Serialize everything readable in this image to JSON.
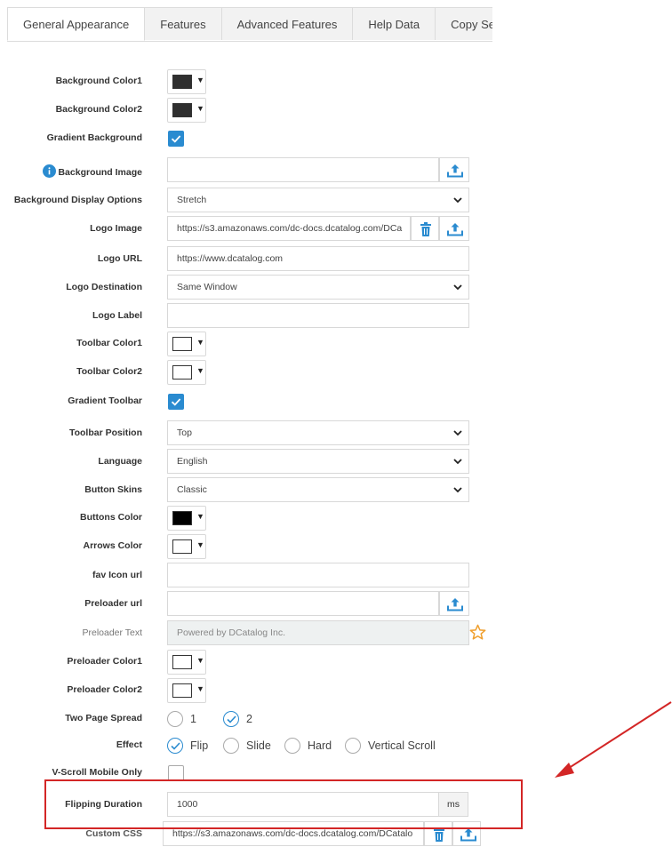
{
  "tabs": [
    "General Appearance",
    "Features",
    "Advanced Features",
    "Help Data",
    "Copy Set"
  ],
  "form": {
    "background_color1": {
      "label": "Background Color1",
      "color": "#2f2f2f"
    },
    "background_color2": {
      "label": "Background Color2",
      "color": "#2f2f2f"
    },
    "gradient_background": {
      "label": "Gradient Background",
      "checked": true
    },
    "background_image": {
      "label": "Background Image",
      "value": ""
    },
    "background_display_options": {
      "label": "Background Display Options",
      "value": "Stretch"
    },
    "logo_image": {
      "label": "Logo Image",
      "value": "https://s3.amazonaws.com/dc-docs.dcatalog.com/DCa"
    },
    "logo_url": {
      "label": "Logo URL",
      "value": "https://www.dcatalog.com"
    },
    "logo_destination": {
      "label": "Logo Destination",
      "value": "Same Window"
    },
    "logo_label": {
      "label": "Logo Label",
      "value": ""
    },
    "toolbar_color1": {
      "label": "Toolbar Color1",
      "color": "#ffffff"
    },
    "toolbar_color2": {
      "label": "Toolbar Color2",
      "color": "#ffffff"
    },
    "gradient_toolbar": {
      "label": "Gradient Toolbar",
      "checked": true
    },
    "toolbar_position": {
      "label": "Toolbar Position",
      "value": "Top"
    },
    "language": {
      "label": "Language",
      "value": "English"
    },
    "button_skins": {
      "label": "Button Skins",
      "value": "Classic"
    },
    "buttons_color": {
      "label": "Buttons Color",
      "color": "#000000"
    },
    "arrows_color": {
      "label": "Arrows Color",
      "color": "#ffffff"
    },
    "fav_icon_url": {
      "label": "fav Icon url",
      "value": ""
    },
    "preloader_url": {
      "label": "Preloader url",
      "value": ""
    },
    "preloader_text": {
      "label": "Preloader Text",
      "value": "Powered by DCatalog Inc."
    },
    "preloader_color1": {
      "label": "Preloader Color1",
      "color": "#ffffff"
    },
    "preloader_color2": {
      "label": "Preloader Color2",
      "color": "#ffffff"
    },
    "two_page_spread": {
      "label": "Two Page Spread",
      "options": [
        "1",
        "2"
      ],
      "selected": "2"
    },
    "effect": {
      "label": "Effect",
      "options": [
        "Flip",
        "Slide",
        "Hard",
        "Vertical Scroll"
      ],
      "selected": "Flip"
    },
    "v_scroll_mobile_only": {
      "label": "V-Scroll Mobile Only",
      "checked": false
    },
    "flipping_duration": {
      "label": "Flipping Duration",
      "value": "1000",
      "unit": "ms"
    },
    "custom_css": {
      "label": "Custom CSS",
      "value": "https://s3.amazonaws.com/dc-docs.dcatalog.com/DCatalo"
    }
  },
  "icons": {
    "info": "info-icon",
    "upload": "upload-icon",
    "trash": "trash-icon",
    "star": "star-icon",
    "chevron": "chevron-down-icon",
    "check": "check-icon"
  },
  "colors": {
    "accent": "#2a8bd0",
    "annotation": "#d32626",
    "star": "#f0a030"
  }
}
